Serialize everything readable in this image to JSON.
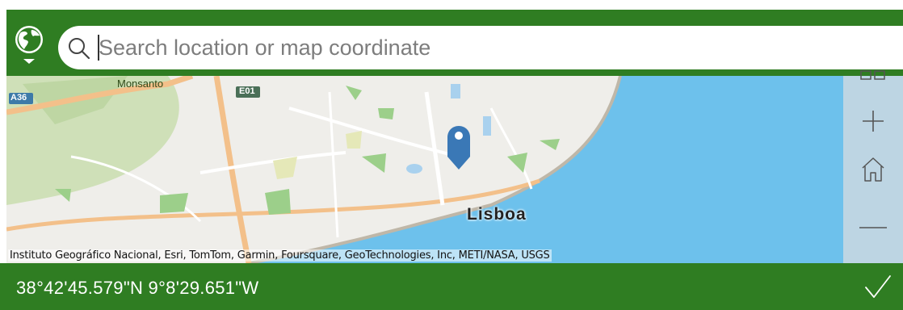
{
  "search": {
    "placeholder": "Search location or map coordinate",
    "icon": "search-icon"
  },
  "globe_button": {
    "icon": "globe-icon"
  },
  "map": {
    "labels": {
      "monsanto": "Monsanto",
      "lisboa": "Lisboa",
      "road_a36": "A36",
      "road_e01": "E01"
    },
    "attribution": "Instituto Geográfico Nacional, Esri, TomTom, Garmin, Foursquare, GeoTechnologies, Inc, METI/NASA, USGS",
    "pin_icon": "map-pin-icon",
    "colors": {
      "land": "#efeeea",
      "water": "#6dc1ec",
      "park": "#c9dcb1",
      "road": "#f3c08a"
    }
  },
  "toolbar": {
    "tools": [
      "layers-icon",
      "zoom-in-icon",
      "home-icon",
      "zoom-out-icon"
    ]
  },
  "bottom_bar": {
    "coordinates": "38°42'45.579\"N 9°8'29.651\"W",
    "confirm_icon": "checkmark-icon"
  },
  "colors": {
    "accent": "#2f7d22",
    "toolbar": "#bdd5e3",
    "pin": "#3a78b6"
  }
}
